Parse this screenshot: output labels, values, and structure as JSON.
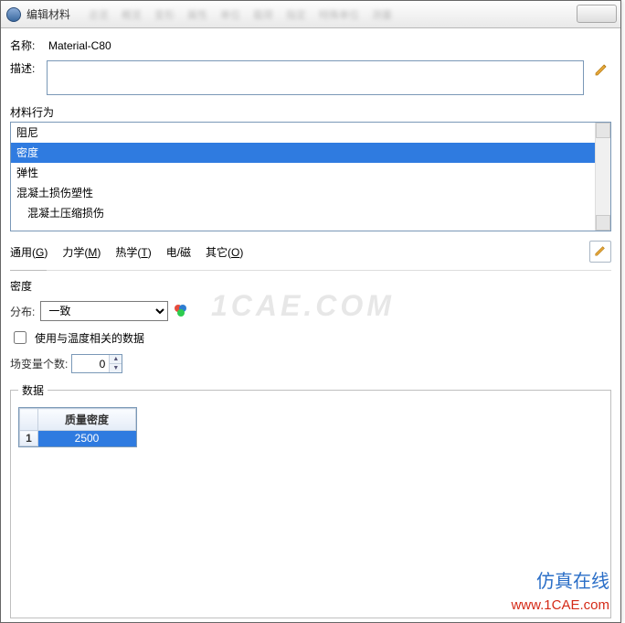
{
  "titlebar": {
    "title": "编辑材料",
    "ghost_menus": [
      "总览",
      "概览",
      "变形",
      "属性",
      "单位",
      "载荷",
      "指定",
      "特殊单位",
      "测量"
    ]
  },
  "form": {
    "name_label": "名称:",
    "name_value": "Material-C80",
    "desc_label": "描述:",
    "desc_value": ""
  },
  "behaviors": {
    "label": "材料行为",
    "items": [
      {
        "label": "阻尼",
        "selected": false,
        "indent": 0
      },
      {
        "label": "密度",
        "selected": true,
        "indent": 0
      },
      {
        "label": "弹性",
        "selected": false,
        "indent": 0
      },
      {
        "label": "混凝土损伤塑性",
        "selected": false,
        "indent": 0
      },
      {
        "label": "混凝土压缩损伤",
        "selected": false,
        "indent": 1
      }
    ]
  },
  "top_menus": {
    "items": [
      {
        "pre": "通用(",
        "u": "G",
        "post": ")"
      },
      {
        "pre": "力学(",
        "u": "M",
        "post": ")"
      },
      {
        "pre": "热学(",
        "u": "T",
        "post": ")"
      },
      {
        "pre": "电/磁",
        "u": "",
        "post": ""
      },
      {
        "pre": "其它(",
        "u": "O",
        "post": ")"
      }
    ]
  },
  "density": {
    "section_title": "密度",
    "dist_label": "分布:",
    "dist_value": "一致",
    "temp_cb_label": "使用与温度相关的数据",
    "temp_cb_checked": false,
    "fieldvar_label": "场变量个数:",
    "fieldvar_value": "0",
    "data_legend": "数据",
    "columns": [
      "质量密度"
    ],
    "rows": [
      {
        "idx": "1",
        "values": [
          "2500"
        ]
      }
    ]
  },
  "watermarks": {
    "center": "1CAE.COM",
    "line1": "仿真在线",
    "line2": "www.1CAE.com"
  }
}
